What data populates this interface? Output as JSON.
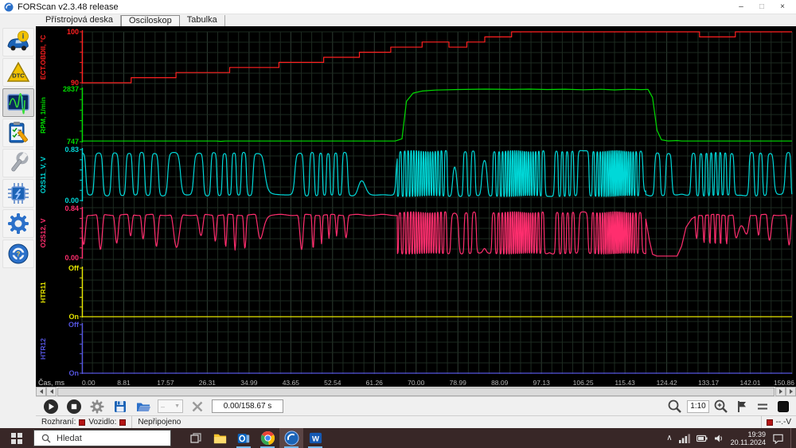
{
  "window": {
    "title": "FORScan v2.3.48 release",
    "controls": {
      "minimize": "–",
      "maximize": "□",
      "close": "×"
    }
  },
  "tabs": [
    {
      "label": "Přístrojová deska",
      "active": false
    },
    {
      "label": "Osciloskop",
      "active": true
    },
    {
      "label": "Tabulka",
      "active": false
    }
  ],
  "sidebar": {
    "items": [
      {
        "name": "vehicle-info"
      },
      {
        "name": "dtc"
      },
      {
        "name": "oscilloscope",
        "active": true
      },
      {
        "name": "tests"
      },
      {
        "name": "service"
      },
      {
        "name": "configuration"
      },
      {
        "name": "settings"
      },
      {
        "name": "help"
      }
    ]
  },
  "scope": {
    "time_axis_label": "Čas, ms",
    "channels": [
      {
        "name": "ECT.OBDII, °C",
        "color": "#ff2020",
        "top": "100",
        "bottom": "90"
      },
      {
        "name": "RPM, 1/min",
        "color": "#00dc00",
        "top": "2837",
        "bottom": "747"
      },
      {
        "name": "O2S11_V, V",
        "color": "#00d8d8",
        "top": "0.83",
        "bottom": "0.00"
      },
      {
        "name": "O2S12, V",
        "color": "#ff2e6e",
        "top": "0.84",
        "bottom": "0.00"
      },
      {
        "name": "HTR11",
        "color": "#e6e600",
        "top": "Off",
        "bottom": "On"
      },
      {
        "name": "HTR12",
        "color": "#5555e0",
        "top": "Off",
        "bottom": "On"
      }
    ]
  },
  "chart_data": {
    "type": "line",
    "title": "FORScan oscilloscope recording",
    "x_label": "Čas, ms",
    "x_range": [
      0,
      158.67
    ],
    "x_ticks": [
      "0.00",
      "8.81",
      "17.57",
      "26.31",
      "34.99",
      "43.65",
      "52.54",
      "61.26",
      "70.00",
      "78.99",
      "88.09",
      "97.13",
      "106.25",
      "115.43",
      "124.42",
      "133.17",
      "142.01",
      "150.86"
    ],
    "series": [
      {
        "name": "ECT.OBDII",
        "unit": "°C",
        "color": "#ff2020",
        "ylim": [
          90,
          100
        ],
        "mode": "linear",
        "points": [
          [
            0,
            90
          ],
          [
            11,
            90
          ],
          [
            11,
            91
          ],
          [
            21,
            91
          ],
          [
            21,
            92
          ],
          [
            33,
            92
          ],
          [
            33,
            93
          ],
          [
            44,
            93
          ],
          [
            44,
            94
          ],
          [
            54,
            94
          ],
          [
            54,
            95
          ],
          [
            62,
            95
          ],
          [
            62,
            96
          ],
          [
            69,
            96
          ],
          [
            69,
            97
          ],
          [
            76,
            97
          ],
          [
            76,
            98
          ],
          [
            82,
            98
          ],
          [
            82,
            97
          ],
          [
            86,
            97
          ],
          [
            86,
            98
          ],
          [
            90,
            98
          ],
          [
            90,
            99
          ],
          [
            96,
            99
          ],
          [
            96,
            100
          ],
          [
            138,
            100
          ],
          [
            138,
            99
          ],
          [
            146,
            99
          ],
          [
            146,
            100
          ],
          [
            158.67,
            100
          ]
        ]
      },
      {
        "name": "RPM",
        "unit": "1/min",
        "color": "#00dc00",
        "ylim": [
          747,
          2837
        ],
        "mode": "linear",
        "points": [
          [
            0,
            772
          ],
          [
            30,
            772
          ],
          [
            31,
            760
          ],
          [
            32,
            772
          ],
          [
            70,
            772
          ],
          [
            71.5,
            860
          ],
          [
            72.5,
            2350
          ],
          [
            74,
            2680
          ],
          [
            76,
            2760
          ],
          [
            79,
            2800
          ],
          [
            84,
            2822
          ],
          [
            90,
            2837
          ],
          [
            96,
            2828
          ],
          [
            100,
            2837
          ],
          [
            104,
            2820
          ],
          [
            108,
            2834
          ],
          [
            112,
            2812
          ],
          [
            116,
            2832
          ],
          [
            119,
            2806
          ],
          [
            122,
            2830
          ],
          [
            125,
            2818
          ],
          [
            126.5,
            2828
          ],
          [
            127.5,
            2500
          ],
          [
            128.5,
            1200
          ],
          [
            129.5,
            820
          ],
          [
            131,
            776
          ],
          [
            133,
            790
          ],
          [
            134,
            772
          ],
          [
            158.67,
            772
          ]
        ]
      },
      {
        "name": "O2S11_V",
        "unit": "V",
        "color": "#00d8d8",
        "ylim": [
          0,
          0.83
        ],
        "mode": "osc",
        "segments": [
          {
            "from": 0,
            "to": 70.5,
            "period": 3.5,
            "low": 0.07,
            "high": 0.79,
            "shape": "square",
            "phase": 1.6
          },
          {
            "from": 70.5,
            "to": 126,
            "period": 1.3,
            "low": 0.06,
            "high": 0.82,
            "shape": "square",
            "phase": 0
          },
          {
            "from": 126,
            "to": 158.67,
            "period": 3.9,
            "low": 0.07,
            "high": 0.79,
            "shape": "square",
            "phase": 2.2
          }
        ]
      },
      {
        "name": "O2S12",
        "unit": "V",
        "color": "#ff2e6e",
        "ylim": [
          0,
          0.84
        ],
        "mode": "osc",
        "segments": [
          {
            "from": 0,
            "to": 70.5,
            "period": 3.5,
            "low": 0.13,
            "high": 0.73,
            "shape": "dips",
            "power": 2.4,
            "phase": 0.9
          },
          {
            "from": 70.5,
            "to": 126,
            "period": 1.3,
            "low": 0.06,
            "high": 0.79,
            "shape": "square",
            "phase": 0.7
          },
          {
            "from": 126,
            "to": 137,
            "shape": "points",
            "points": [
              [
                126,
                0.66
              ],
              [
                126.8,
                0.3
              ],
              [
                127.5,
                0.06
              ],
              [
                128.5,
                0.03
              ],
              [
                133,
                0.03
              ],
              [
                134,
                0.2
              ],
              [
                135,
                0.52
              ],
              [
                136.2,
                0.66
              ],
              [
                137,
                0.7
              ]
            ]
          },
          {
            "from": 137,
            "to": 158.67,
            "period": 4.6,
            "low": 0.2,
            "high": 0.73,
            "shape": "dips",
            "power": 1.7,
            "phase": 0.4
          }
        ]
      },
      {
        "name": "HTR11",
        "unit": "state",
        "color": "#e6e600",
        "mode": "flat-bottom",
        "state": "On"
      },
      {
        "name": "HTR12",
        "unit": "state",
        "color": "#5555e0",
        "mode": "flat-bottom",
        "state": "On"
      }
    ]
  },
  "scrollbar": {
    "position": "full"
  },
  "toolbar": {
    "time_display": "0.00/158.67 s",
    "zoom_ratio": "1:10",
    "combo_value": "–"
  },
  "statusbar": {
    "interface_label": "Rozhraní:",
    "vehicle_label": "Vozidlo:",
    "connection_status": "Nepřipojeno",
    "voltage": "--.-V"
  },
  "taskbar": {
    "search_placeholder": "Hledat",
    "clock_time": "19:39",
    "clock_date": "20.11.2024"
  }
}
